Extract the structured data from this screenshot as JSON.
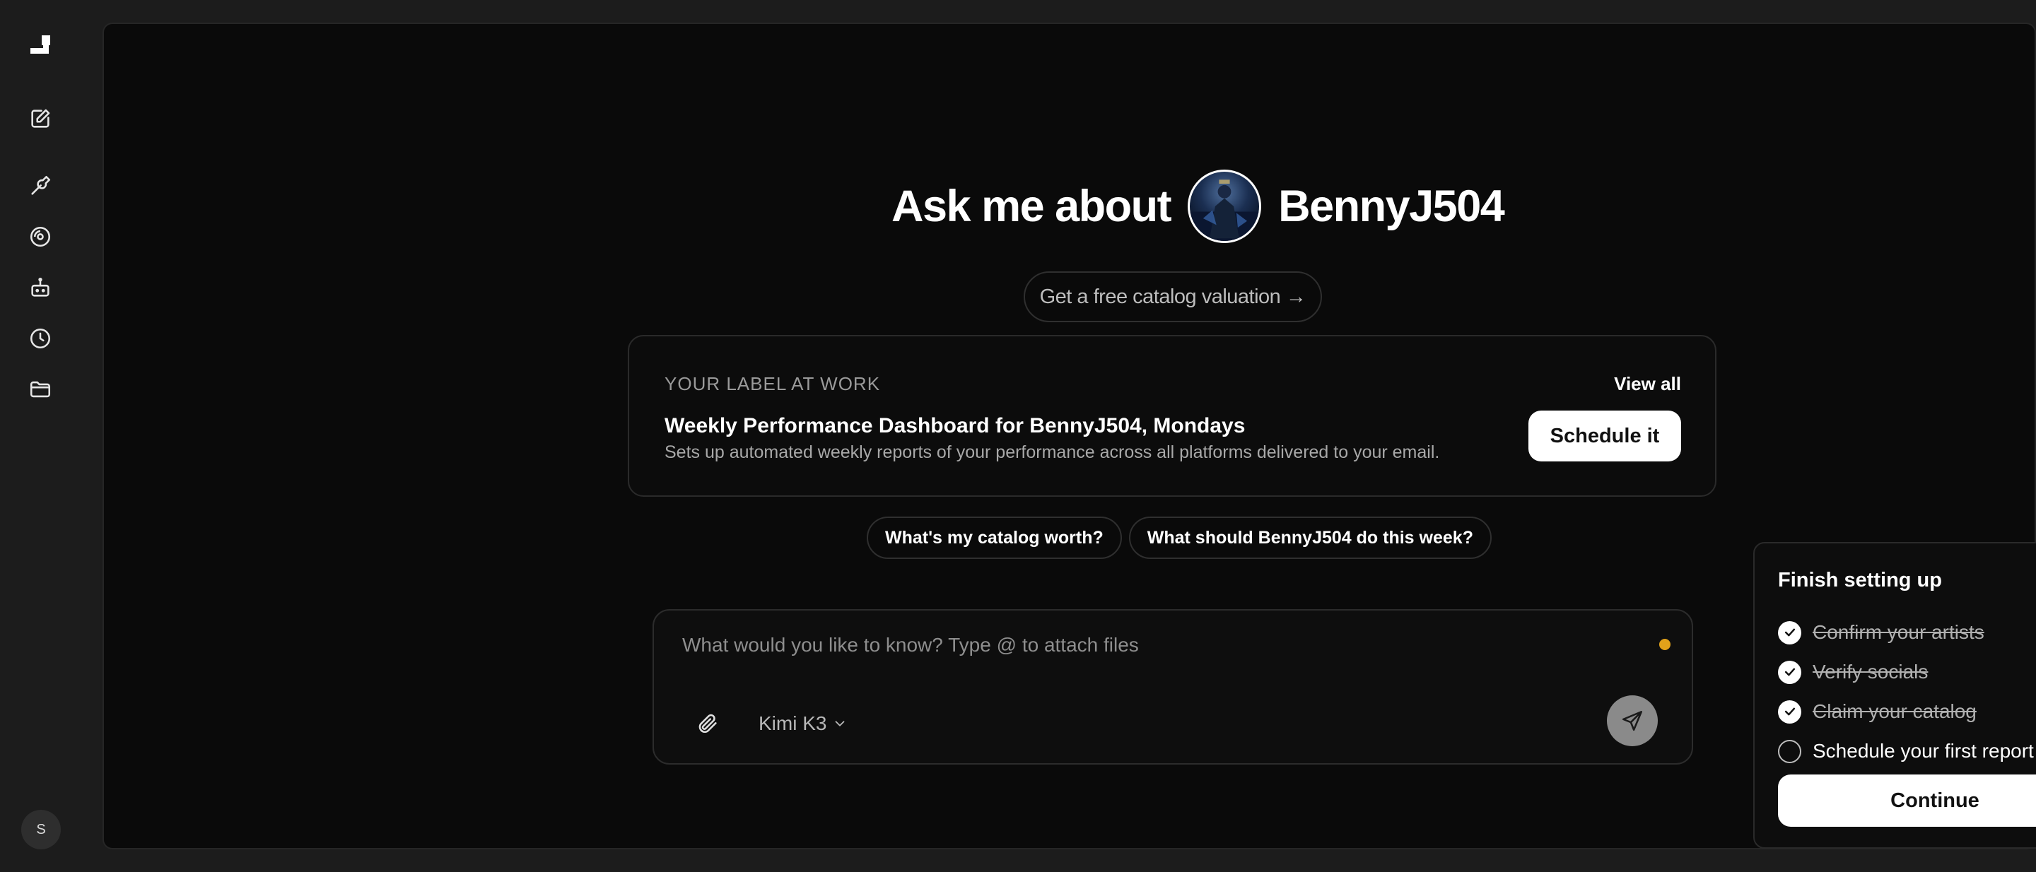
{
  "rail": {
    "items": [
      {
        "icon": "logo-icon"
      },
      {
        "icon": "new-chat-icon"
      },
      {
        "icon": "wrench-icon"
      },
      {
        "icon": "vinyl-record-icon"
      },
      {
        "icon": "robot-icon"
      },
      {
        "icon": "clock-icon"
      },
      {
        "icon": "folder-icon"
      }
    ],
    "user_initial": "S"
  },
  "hero": {
    "prefix": "Ask me about",
    "artist_name": "BennyJ504"
  },
  "valuation_link": "Get a free catalog valuation →",
  "label_card": {
    "eyebrow": "YOUR LABEL AT WORK",
    "view_all": "View all",
    "title": "Weekly Performance Dashboard for BennyJ504, Mondays",
    "description": "Sets up automated weekly reports of your performance across all platforms delivered to your email.",
    "cta": "Schedule it"
  },
  "suggestions": [
    "What's my catalog worth?",
    "What should BennyJ504 do this week?"
  ],
  "composer": {
    "placeholder": "What would you like to know? Type @ to attach files",
    "value": "",
    "model": "Kimi K3",
    "status_color": "#e2a21a"
  },
  "setup": {
    "title": "Finish setting up",
    "items": [
      {
        "label": "Confirm your artists",
        "done": true
      },
      {
        "label": "Verify socials",
        "done": true
      },
      {
        "label": "Claim your catalog",
        "done": true
      },
      {
        "label": "Schedule your first report",
        "done": false
      }
    ],
    "continue_label": "Continue"
  },
  "colors": {
    "background": "#1c1c1c",
    "panel": "#0a0a0a",
    "accent_dot": "#e2a21a",
    "primary_button": "#ffffff"
  }
}
